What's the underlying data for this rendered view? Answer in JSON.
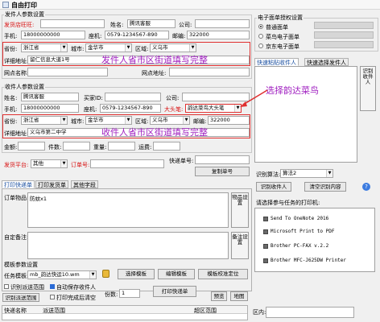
{
  "window": {
    "title": "自由打印"
  },
  "sender": {
    "group_label": "发件人参数设置",
    "shop_label": "发货店旺旺:",
    "name_label": "姓名:",
    "name_value": "腾讯客服",
    "company_label": "公司:",
    "mobile_label": "手机:",
    "mobile_value": "18000000000",
    "tel_label": "座机:",
    "tel_value": "0579-1234567-890",
    "zip_label": "邮编:",
    "zip_value": "322000",
    "province_label": "省份:",
    "province_value": "浙江省",
    "city_label": "城市:",
    "city_value": "金华市",
    "district_label": "区域:",
    "district_value": "义乌市",
    "address_label": "详细地址:",
    "address_value": "留仁信息大道1号",
    "site_label": "网点名称:",
    "site_addr_label": "网点地址:",
    "overlay_note": "发件人省市区街道填写完整"
  },
  "receiver": {
    "group_label": "收件人参数设置",
    "name_label": "姓名:",
    "name_value": "腾讯客服",
    "buyer_id_label": "买家ID:",
    "company_label": "公司:",
    "mobile_label": "手机:",
    "mobile_value": "18000000000",
    "tel_label": "座机:",
    "tel_value": "0579-1234567-890",
    "bigpen_label": "大头笔:",
    "bigpen_value": "韵达菜鸟大头笔",
    "province_label": "省份:",
    "province_value": "浙江省",
    "city_label": "城市:",
    "city_value": "金华市",
    "district_label": "区域:",
    "district_value": "义乌市",
    "zip_label": "邮编:",
    "zip_value": "322000",
    "address_label": "详细地址:",
    "address_value": "义乌市第二中学",
    "overlay_note": "收件人省市区街道填写完整",
    "amount_label": "金额:",
    "pieces_label": "件数:",
    "weight_label": "重量:",
    "freight_label": "运费:"
  },
  "shipping": {
    "platform_label": "发货平台:",
    "platform_value": "其他",
    "order_label": "订单号:",
    "tracking_label": "快递单号:",
    "copy_tracking_button": "复制单号"
  },
  "tabs": [
    "打印快递单",
    "打印发货单",
    "其他字段"
  ],
  "order_goods_label": "订单物品:",
  "order_goods_value": "防蚊x1",
  "custom_note_label": "自定备注:",
  "side_buttons": {
    "goods": "物品设置",
    "note": "备注设置"
  },
  "template": {
    "group_label": "模板参数设置",
    "task_label": "任务模板:",
    "task_value": "mb_韵达快运10.wm",
    "select_button": "选择模板",
    "edit_button": "编辑模板",
    "calibrate_button": "模板校准定位",
    "opt_refresh": "识别派送范围",
    "opt_autosave": "自动保存收件人",
    "opt_print_done": "打印完成后清空",
    "identify_button": "识别派送范围",
    "copies_label": "份数:",
    "copies_value": "1",
    "print_button": "打印快递单",
    "preview_button": "预览",
    "map_button": "地图"
  },
  "bottom_table": {
    "headers": [
      "快递名称",
      "派送范围",
      "超区范围",
      "区内:"
    ]
  },
  "right": {
    "auth_group_label": "电子面单授权设置",
    "radio_normal": "普通面单",
    "radio_cainiao": "菜鸟电子面单",
    "radio_jd": "京东电子面单",
    "tab_receiver": "快速粘贴收件人",
    "tab_sender": "快速选择发件人",
    "overlay_note": "选择韵达菜鸟",
    "identify_receiver_button": "识别收件人",
    "identify_algo_label": "识别算法:",
    "identify_algo_value": "算法2",
    "identify_receiver_btn2": "识别收件人",
    "clear_button": "清空识别内容",
    "printer_label": "请选择参与任务的打印机:",
    "printers": [
      "Send To OneNote 2016",
      "Microsoft Print to PDF",
      "Brother PC-FAX v.2.2",
      "Brother MFC-J625DW Printer"
    ]
  },
  "colors": {
    "accent_red": "#d81010",
    "overlay_purple": "#a020c0",
    "box_red": "#e03030"
  }
}
